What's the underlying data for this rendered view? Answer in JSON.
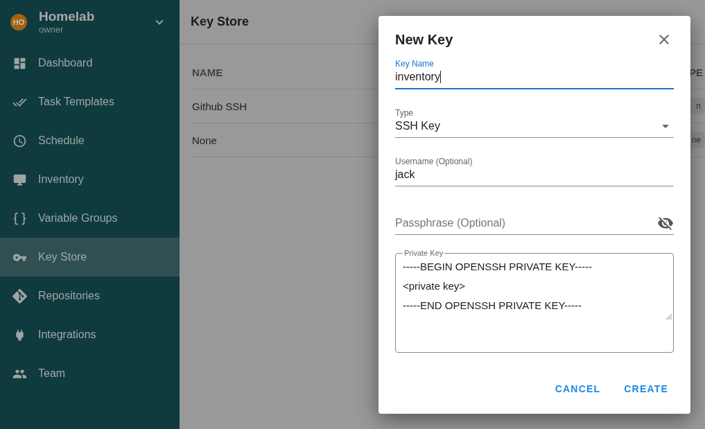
{
  "team": {
    "name": "Homelab",
    "role": "owner",
    "initials": "HO"
  },
  "sidebar": {
    "items": [
      {
        "label": "Dashboard",
        "selected": false
      },
      {
        "label": "Task Templates",
        "selected": false
      },
      {
        "label": "Schedule",
        "selected": false
      },
      {
        "label": "Inventory",
        "selected": false
      },
      {
        "label": "Variable Groups",
        "selected": false
      },
      {
        "label": "Key Store",
        "selected": true
      },
      {
        "label": "Repositories",
        "selected": false
      },
      {
        "label": "Integrations",
        "selected": false
      },
      {
        "label": "Team",
        "selected": false
      }
    ]
  },
  "page": {
    "title": "Key Store"
  },
  "table": {
    "columns": [
      "NAME",
      "PE"
    ],
    "rows": [
      [
        "Github SSH",
        "n"
      ],
      [
        "None",
        "ne"
      ]
    ]
  },
  "dialog": {
    "title": "New Key",
    "fields": [
      {
        "kind": "text",
        "label": "Key Name",
        "value": "inventory",
        "focused": true
      },
      {
        "kind": "select",
        "label": "Type",
        "value": "SSH Key",
        "focused": false
      },
      {
        "kind": "text",
        "label": "Username (Optional)",
        "value": "jack",
        "focused": false
      },
      {
        "kind": "password",
        "placeholder": "Passphrase (Optional)",
        "focused": false
      },
      {
        "kind": "textarea",
        "label": "Private Key",
        "lines": [
          "-----BEGIN OPENSSH PRIVATE KEY-----",
          "<private key>",
          "-----END OPENSSH PRIVATE KEY-----"
        ],
        "focused": false
      }
    ],
    "buttons": [
      "CANCEL",
      "CREATE"
    ]
  }
}
